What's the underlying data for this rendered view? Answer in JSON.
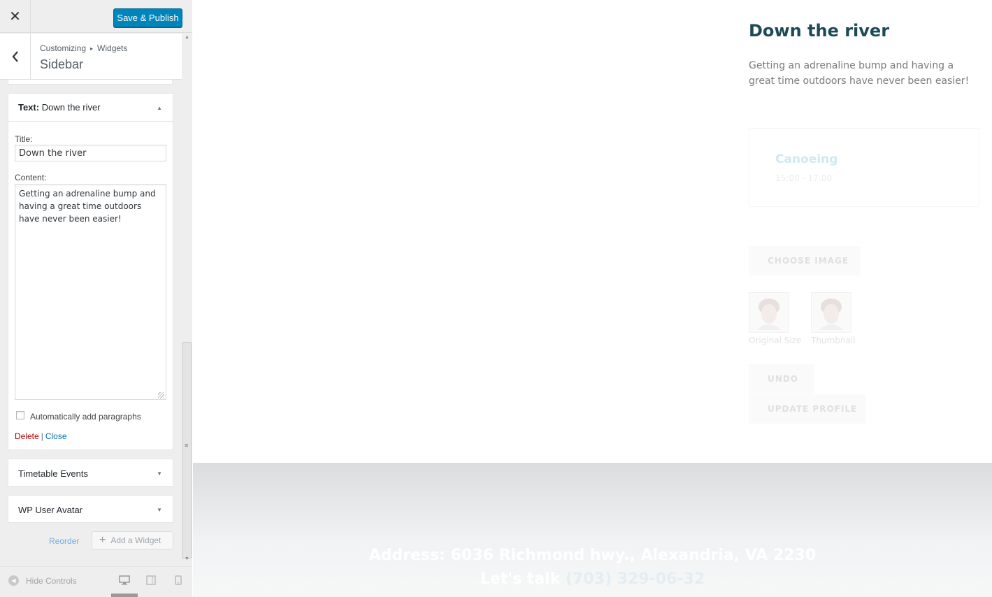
{
  "topbar": {
    "close_label": "✕",
    "publish_label": "Save & Publish"
  },
  "section": {
    "breadcrumb_parent": "Customizing",
    "breadcrumb_separator": "▸",
    "breadcrumb_child": "Widgets",
    "title": "Sidebar"
  },
  "widgets": [
    {
      "type_label": "Text:",
      "name": "Down the river",
      "expanded": true,
      "title_label": "Title:",
      "title_value": "Down the river",
      "content_label": "Content:",
      "content_value": "Getting an adrenaline bump and having a great time outdoors have never been easier!",
      "autop_label": "Automatically add paragraphs",
      "autop_checked": false,
      "delete_label": "Delete",
      "separator": "|",
      "close_label": "Close"
    },
    {
      "name": "Timetable Events",
      "expanded": false
    },
    {
      "name": "WP User Avatar",
      "expanded": false
    }
  ],
  "actions": {
    "reorder_label": "Reorder",
    "add_widget_label": "Add a Widget"
  },
  "footer": {
    "hide_controls_label": "Hide Controls",
    "devices": [
      "desktop-icon",
      "tablet-icon",
      "mobile-icon"
    ],
    "active_device": "desktop"
  },
  "preview": {
    "widget_title": "Down the river",
    "widget_text": "Getting an adrenaline bump and having a great time outdoors have never been easier!",
    "event_name": "Canoeing",
    "event_time": "15:00 - 17:00",
    "choose_image_label": "CHOOSE IMAGE",
    "avatar_labels": [
      "Original Size",
      "Thumbnail"
    ],
    "undo_label": "UNDO",
    "update_profile_label": "UPDATE PROFILE",
    "footer_address": "Address: 6036 Richmond hwy., Alexandria, VA 2230",
    "footer_talk": "Let's talk",
    "footer_phone": "(703) 329-06-32"
  },
  "colors": {
    "accent": "#0085ba",
    "title": "#1c4a57",
    "delete": "#aa0000",
    "link": "#0073aa"
  }
}
